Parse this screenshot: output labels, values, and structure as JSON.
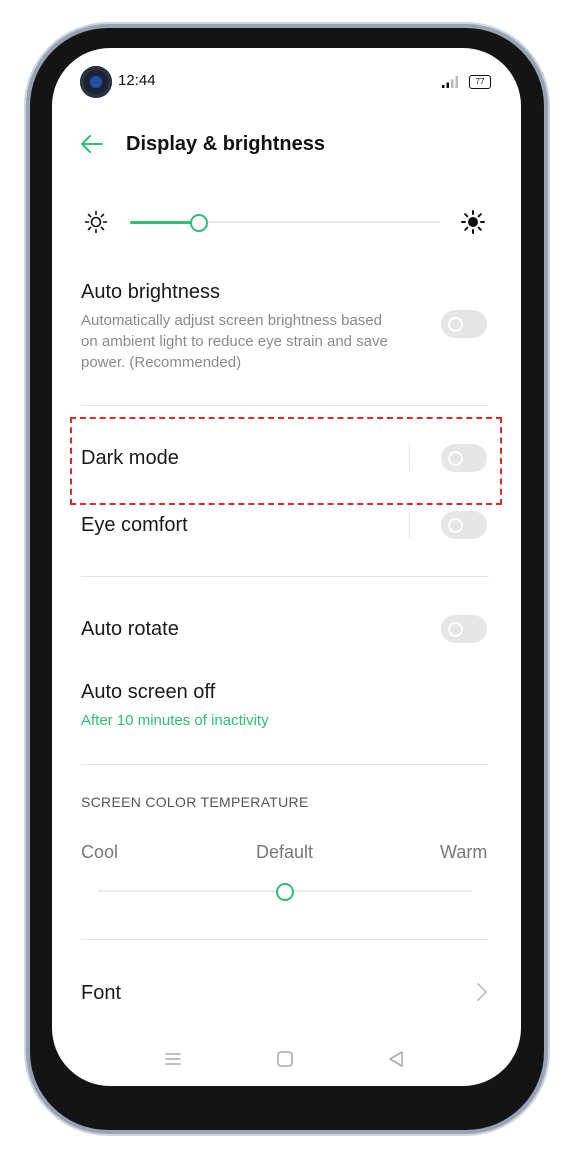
{
  "status_bar": {
    "time": "12:44",
    "battery": "77"
  },
  "header": {
    "title": "Display & brightness"
  },
  "brightness": {
    "level": 0.22,
    "low_icon": "sun-outline-icon",
    "high_icon": "sun-filled-icon"
  },
  "settings": {
    "auto_brightness": {
      "title": "Auto brightness",
      "subtitle_1": "Automatically adjust screen brightness based",
      "subtitle_2": "on ambient light to reduce eye strain and save",
      "subtitle_3": "power. (Recommended)",
      "enabled": false
    },
    "dark_mode": {
      "title": "Dark mode",
      "enabled": false
    },
    "eye_comfort": {
      "title": "Eye comfort",
      "enabled": false
    },
    "auto_rotate": {
      "title": "Auto rotate",
      "enabled": false
    },
    "auto_screen_off": {
      "title": "Auto screen off",
      "value": "After 10 minutes of inactivity"
    }
  },
  "color_temperature": {
    "section_title": "SCREEN COLOR TEMPERATURE",
    "cool": "Cool",
    "default": "Default",
    "warm": "Warm",
    "level": 0.5
  },
  "font": {
    "title": "Font"
  },
  "colors": {
    "accent": "#2fbf71",
    "highlight": "#d92b2b"
  }
}
